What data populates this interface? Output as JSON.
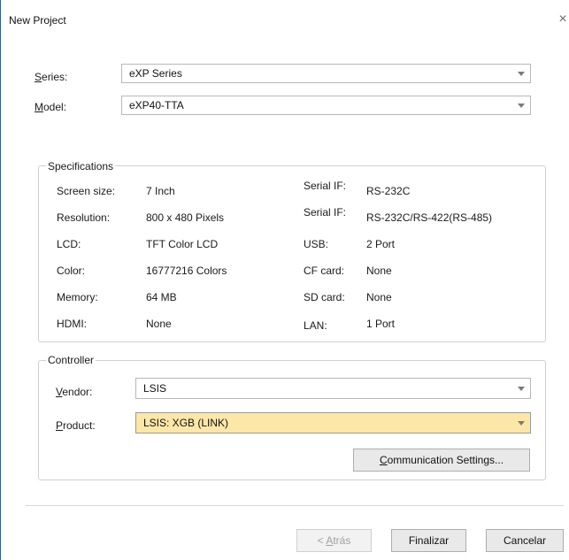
{
  "dialog": {
    "title": "New Project",
    "close_glyph": "×"
  },
  "series": {
    "label_first": "S",
    "label_rest": "eries:",
    "value": "eXP Series"
  },
  "model": {
    "label_first": "M",
    "label_rest": "odel:",
    "value": "eXP40-TTA"
  },
  "specifications": {
    "title": "Specifications",
    "left": [
      {
        "label": "Screen size:",
        "value": "7 Inch"
      },
      {
        "label": "Resolution:",
        "value": "800 x 480 Pixels"
      },
      {
        "label": "LCD:",
        "value": "TFT Color LCD"
      },
      {
        "label": "Color:",
        "value": "16777216 Colors"
      },
      {
        "label": "Memory:",
        "value": "64 MB"
      },
      {
        "label": "HDMI:",
        "value": "None"
      }
    ],
    "right": [
      {
        "label": "Serial IF:",
        "value": "RS-232C"
      },
      {
        "label": "Serial IF:",
        "value": "RS-232C/RS-422(RS-485)"
      },
      {
        "label": "USB:",
        "value": "2 Port"
      },
      {
        "label": "CF card:",
        "value": "None"
      },
      {
        "label": "SD card:",
        "value": "None"
      },
      {
        "label": "LAN:",
        "value": "1 Port"
      }
    ]
  },
  "controller": {
    "title": "Controller",
    "vendor_label_first": "V",
    "vendor_label_rest": "endor:",
    "vendor_value": "LSIS",
    "product_label_first": "P",
    "product_label_rest": "roduct:",
    "product_value": "LSIS: XGB (LINK)",
    "comm_first": "C",
    "comm_rest": "ommunication Settings..."
  },
  "buttons": {
    "back_prefix": "< ",
    "back_first": "A",
    "back_rest": "trás",
    "finish": "Finalizar",
    "cancel": "Cancelar"
  },
  "colors": {
    "highlight": "#fde7a8",
    "window_border": "#2b5fa8"
  }
}
